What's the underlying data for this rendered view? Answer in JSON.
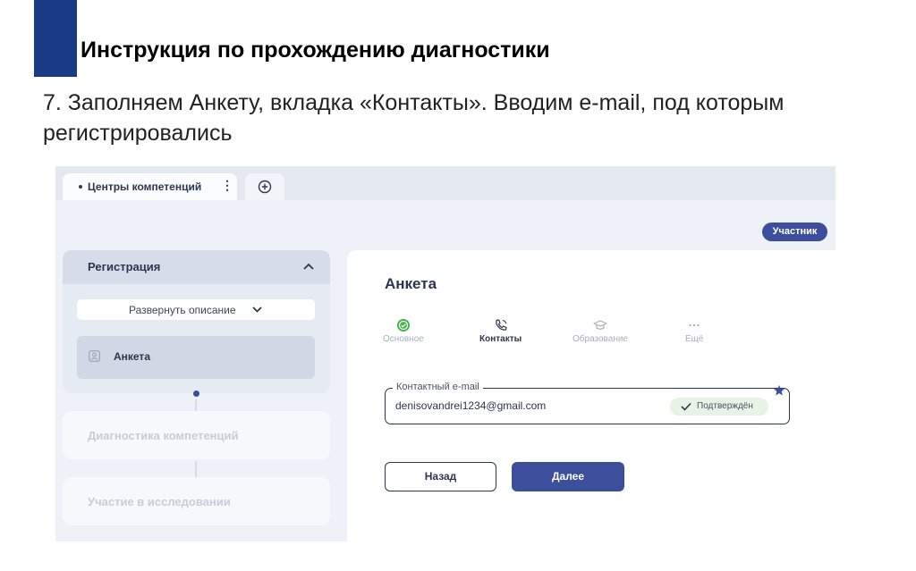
{
  "slide": {
    "title": "Инструкция по прохождению диагностики",
    "text": "7. Заполняем Анкету, вкладка «Контакты». Вводим e-mail, под которым регистрировались"
  },
  "browser": {
    "tab_label": "Центры компетенций",
    "icons": {
      "tab_menu": "more-vertical-icon",
      "add_tab": "plus-circle-icon"
    }
  },
  "role_badge": "Участник",
  "sidebar": {
    "section_title": "Регистрация",
    "expand_label": "Развернуть описание",
    "active_item": "Анкета",
    "steps": [
      {
        "label": "Диагностика компетенций"
      },
      {
        "label": "Участие в исследовании"
      }
    ]
  },
  "form": {
    "heading": "Анкета",
    "tabs": [
      {
        "label": "Основное",
        "icon": "check-circle-icon",
        "state": "done"
      },
      {
        "label": "Контакты",
        "icon": "phone-icon",
        "state": "active"
      },
      {
        "label": "Образование",
        "icon": "graduation-cap-icon",
        "state": "inactive"
      },
      {
        "label": "Ещё",
        "icon": "more-horizontal-icon",
        "state": "inactive"
      }
    ],
    "email": {
      "label": "Контактный e-mail",
      "value": "denisovandrei1234@gmail.com",
      "status": "Подтверждён"
    },
    "back_label": "Назад",
    "next_label": "Далее"
  },
  "colors": {
    "accent": "#1a3a86",
    "primary_button": "#3d4f9c",
    "success": "#3cb64a",
    "success_bg": "#e7f3e6"
  }
}
